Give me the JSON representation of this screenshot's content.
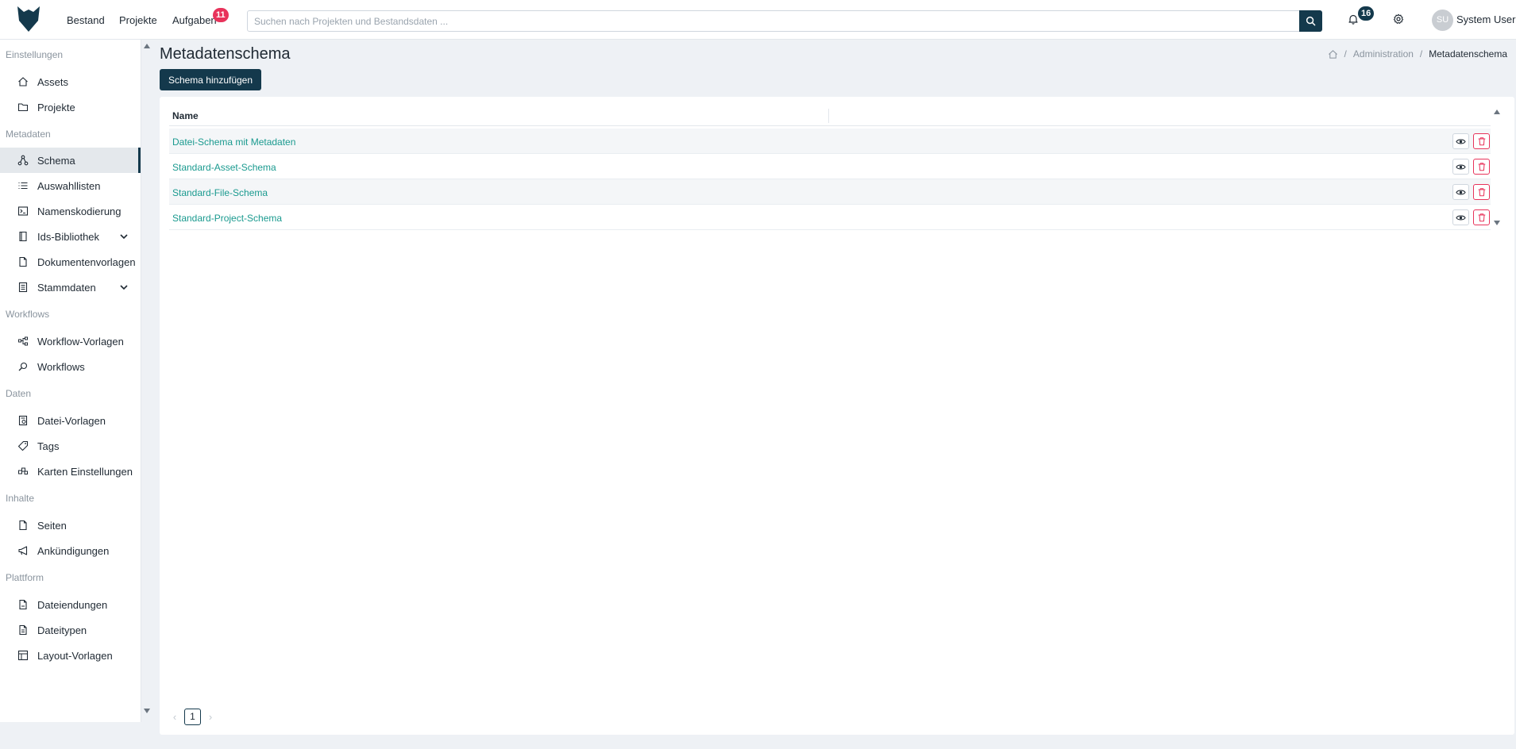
{
  "topnav": {
    "items": [
      {
        "label": "Bestand"
      },
      {
        "label": "Projekte"
      },
      {
        "label": "Aufgaben",
        "badge": "11"
      }
    ],
    "search": {
      "placeholder": "Suchen nach Projekten und Bestandsdaten ...",
      "value": ""
    },
    "notifications_count": "16",
    "user": {
      "initials": "SU",
      "name": "System User"
    }
  },
  "sidebar": {
    "sections": [
      {
        "title": "Einstellungen",
        "items": [
          {
            "label": "Assets",
            "icon": "home-icon"
          },
          {
            "label": "Projekte",
            "icon": "folder-icon"
          }
        ]
      },
      {
        "title": "Metadaten",
        "items": [
          {
            "label": "Schema",
            "icon": "schema-icon",
            "active": true
          },
          {
            "label": "Auswahllisten",
            "icon": "list-icon"
          },
          {
            "label": "Namenskodierung",
            "icon": "terminal-icon"
          },
          {
            "label": "Ids-Bibliothek",
            "icon": "book-icon",
            "expandable": true
          },
          {
            "label": "Dokumentenvorlagen",
            "icon": "document-icon"
          },
          {
            "label": "Stammdaten",
            "icon": "database-icon",
            "expandable": true
          }
        ]
      },
      {
        "title": "Workflows",
        "items": [
          {
            "label": "Workflow-Vorlagen",
            "icon": "workflow-icon"
          },
          {
            "label": "Workflows",
            "icon": "search-workflow-icon"
          }
        ]
      },
      {
        "title": "Daten",
        "items": [
          {
            "label": "Datei-Vorlagen",
            "icon": "file-template-icon"
          },
          {
            "label": "Tags",
            "icon": "tag-icon"
          },
          {
            "label": "Karten Einstellungen",
            "icon": "map-settings-icon"
          }
        ]
      },
      {
        "title": "Inhalte",
        "items": [
          {
            "label": "Seiten",
            "icon": "page-icon"
          },
          {
            "label": "Ankündigungen",
            "icon": "megaphone-icon"
          }
        ]
      },
      {
        "title": "Plattform",
        "items": [
          {
            "label": "Dateiendungen",
            "icon": "file-extension-icon"
          },
          {
            "label": "Dateitypen",
            "icon": "file-type-icon"
          },
          {
            "label": "Layout-Vorlagen",
            "icon": "layout-icon"
          }
        ]
      }
    ]
  },
  "main": {
    "title": "Metadatenschema",
    "breadcrumb": {
      "items": [
        "Administration",
        "Metadatenschema"
      ]
    },
    "add_button": "Schema hinzufügen",
    "table": {
      "column_name": "Name",
      "rows": [
        "Datei-Schema mit Metadaten",
        "Standard-Asset-Schema",
        "Standard-File-Schema",
        "Standard-Project-Schema"
      ]
    },
    "pagination": {
      "current_page": "1"
    }
  },
  "colors": {
    "primary": "#14394c",
    "link": "#1a9a8f",
    "danger": "#e8335b",
    "background": "#eef1f5"
  }
}
